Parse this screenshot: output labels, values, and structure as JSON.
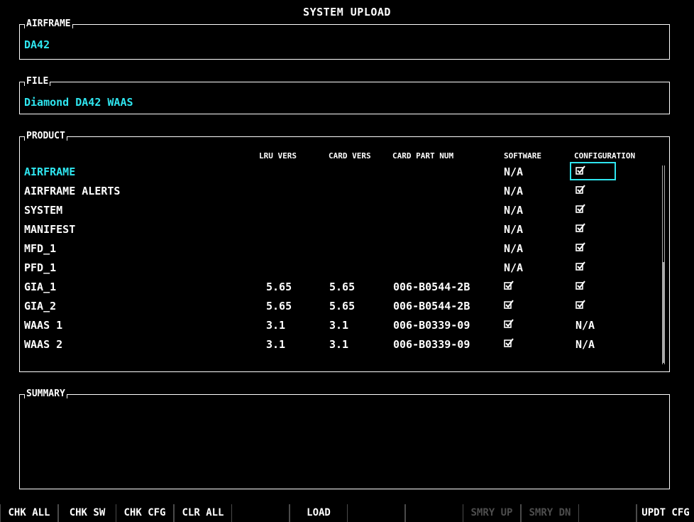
{
  "page_title": "SYSTEM UPLOAD",
  "airframe": {
    "label": "AIRFRAME",
    "value": "DA42"
  },
  "file": {
    "label": "FILE",
    "value": "Diamond DA42 WAAS"
  },
  "product": {
    "label": "PRODUCT",
    "columns": {
      "lru_vers": "LRU VERS",
      "card_vers": "CARD VERS",
      "card_part_num": "CARD PART NUM",
      "software": "SOFTWARE",
      "configuration": "CONFIGURATION"
    },
    "rows": [
      {
        "name": "AIRFRAME",
        "lru": "",
        "card": "",
        "part": "",
        "software": "N/A",
        "config": "check",
        "selected": true
      },
      {
        "name": "AIRFRAME ALERTS",
        "lru": "",
        "card": "",
        "part": "",
        "software": "N/A",
        "config": "check"
      },
      {
        "name": "SYSTEM",
        "lru": "",
        "card": "",
        "part": "",
        "software": "N/A",
        "config": "check"
      },
      {
        "name": "MANIFEST",
        "lru": "",
        "card": "",
        "part": "",
        "software": "N/A",
        "config": "check"
      },
      {
        "name": "MFD_1",
        "lru": "",
        "card": "",
        "part": "",
        "software": "N/A",
        "config": "check"
      },
      {
        "name": "PFD_1",
        "lru": "",
        "card": "",
        "part": "",
        "software": "N/A",
        "config": "check"
      },
      {
        "name": "GIA_1",
        "lru": "5.65",
        "card": "5.65",
        "part": "006-B0544-2B",
        "software": "check",
        "config": "check"
      },
      {
        "name": "GIA_2",
        "lru": "5.65",
        "card": "5.65",
        "part": "006-B0544-2B",
        "software": "check",
        "config": "check"
      },
      {
        "name": "WAAS 1",
        "lru": "3.1",
        "card": "3.1",
        "part": "006-B0339-09",
        "software": "check",
        "config": "N/A"
      },
      {
        "name": "WAAS 2",
        "lru": "3.1",
        "card": "3.1",
        "part": "006-B0339-09",
        "software": "check",
        "config": "N/A"
      }
    ]
  },
  "summary": {
    "label": "SUMMARY"
  },
  "softkeys": [
    {
      "label": "CHK ALL",
      "enabled": true
    },
    {
      "label": "CHK SW",
      "enabled": true
    },
    {
      "label": "CHK CFG",
      "enabled": true
    },
    {
      "label": "CLR ALL",
      "enabled": true
    },
    {
      "label": "",
      "enabled": false
    },
    {
      "label": "LOAD",
      "enabled": true
    },
    {
      "label": "",
      "enabled": false
    },
    {
      "label": "",
      "enabled": false
    },
    {
      "label": "SMRY UP",
      "enabled": false
    },
    {
      "label": "SMRY DN",
      "enabled": false
    },
    {
      "label": "",
      "enabled": false
    },
    {
      "label": "UPDT CFG",
      "enabled": true
    }
  ],
  "colors": {
    "accent": "#2fe6f0",
    "background": "#000000",
    "text": "#ffffff",
    "disabled": "#4d4d4d"
  },
  "icons": {
    "check": "checkbox-checked-icon"
  }
}
